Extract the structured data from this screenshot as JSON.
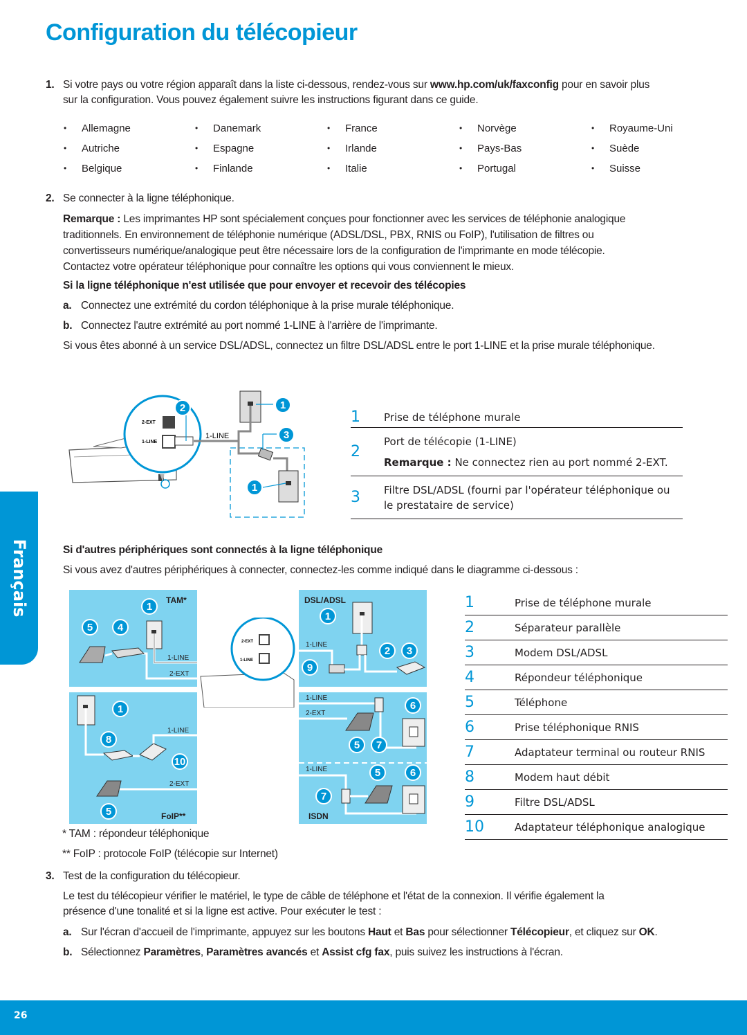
{
  "page": {
    "title": "Configuration du télécopieur",
    "language_tab": "Français",
    "page_number": "26",
    "accent_color": "#0096d6"
  },
  "step1": {
    "number": "1.",
    "text_before": "Si votre pays ou votre région apparaît dans la liste ci-dessous, rendez-vous sur ",
    "link": "www.hp.com/uk/faxconfig",
    "text_after": " pour en savoir plus",
    "line2": "sur la configuration. Vous pouvez également suivre les instructions figurant dans ce guide.",
    "countries": [
      "Allemagne",
      "Danemark",
      "France",
      "Norvège",
      "Royaume-Uni",
      "Autriche",
      "Espagne",
      "Irlande",
      "Pays-Bas",
      "Suède",
      "Belgique",
      "Finlande",
      "Italie",
      "Portugal",
      "Suisse"
    ]
  },
  "step2": {
    "number": "2.",
    "heading": "Se connecter à la ligne téléphonique.",
    "note_label": "Remarque :",
    "note_lines": [
      " Les imprimantes HP sont spécialement conçues pour fonctionner avec les services de téléphonie analogique",
      "traditionnels. En environnement de téléphonie numérique (ADSL/DSL, PBX, RNIS ou FoIP), l'utilisation de filtres ou",
      "convertisseurs numérique/analogique peut être nécessaire lors de la configuration de l'imprimante en mode télécopie.",
      "Contactez votre opérateur téléphonique pour connaître les options qui vous conviennent le mieux."
    ],
    "subheading1": "Si la ligne téléphonique n'est utilisée que pour envoyer et recevoir des télécopies",
    "sub_a_label": "a.",
    "sub_a": "Connectez une extrémité du cordon téléphonique à la prise murale téléphonique.",
    "sub_b_label": "b.",
    "sub_b": "Connectez l'autre extrémité au port nommé 1-LINE à l'arrière de l'imprimante.",
    "dsl_note": "Si vous êtes abonné à un service DSL/ADSL, connectez un filtre DSL/ADSL entre le port 1-LINE et la prise murale téléphonique.",
    "diagram1": {
      "port_2ext": "2-EXT",
      "port_1line": "1-LINE",
      "cable_label": "1-LINE",
      "badges": [
        "2",
        "1",
        "3",
        "1"
      ]
    },
    "legend1": [
      {
        "num": "1",
        "text": "Prise de téléphone murale"
      },
      {
        "num": "2",
        "text": "Port de télécopie (1-LINE)",
        "note_label": "Remarque :",
        "note": " Ne connectez rien au port nommé 2-EXT."
      },
      {
        "num": "3",
        "text": "Filtre DSL/ADSL (fourni par l'opérateur téléphonique ou",
        "text2": "le prestataire de service)"
      }
    ],
    "subheading2": "Si d'autres périphériques sont connectés à la ligne téléphonique",
    "sub2_text": "Si vous avez d'autres périphériques à connecter, connectez-les comme indiqué dans le diagramme ci-dessous :",
    "diagram2": {
      "panels": {
        "tam": "TAM*",
        "dsl": "DSL/ADSL",
        "foip": "FoIP**",
        "isdn": "ISDN"
      },
      "line_1line": "1-LINE",
      "line_2ext": "2-EXT"
    },
    "legend2": [
      {
        "num": "1",
        "text": "Prise de téléphone murale"
      },
      {
        "num": "2",
        "text": "Séparateur parallèle"
      },
      {
        "num": "3",
        "text": "Modem DSL/ADSL"
      },
      {
        "num": "4",
        "text": "Répondeur téléphonique"
      },
      {
        "num": "5",
        "text": "Téléphone"
      },
      {
        "num": "6",
        "text": "Prise téléphonique RNIS"
      },
      {
        "num": "7",
        "text": "Adaptateur terminal ou routeur RNIS"
      },
      {
        "num": "8",
        "text": "Modem haut débit"
      },
      {
        "num": "9",
        "text": "Filtre DSL/ADSL"
      },
      {
        "num": "10",
        "text": "Adaptateur téléphonique analogique"
      }
    ],
    "footnote1": "*  TAM : répondeur téléphonique",
    "footnote2": "**  FoIP : protocole FoIP (télécopie sur Internet)"
  },
  "step3": {
    "number": "3.",
    "heading": "Test de la configuration du télécopieur.",
    "para1": "Le test du télécopieur vérifier le matériel, le type de câble de téléphone et l'état de la connexion. Il vérifie également la",
    "para2": "présence d'une tonalité et si la ligne est active. Pour exécuter le test :",
    "a_label": "a.",
    "a_parts": [
      "Sur l'écran d'accueil de l'imprimante, appuyez sur les boutons ",
      "Haut",
      " et ",
      "Bas",
      " pour sélectionner ",
      "Télécopieur",
      ", et cliquez sur ",
      "OK",
      "."
    ],
    "b_label": "b.",
    "b_parts": [
      "Sélectionnez ",
      "Paramètres",
      ", ",
      "Paramètres avancés",
      " et ",
      "Assist cfg fax",
      ", puis suivez les instructions à l'écran."
    ]
  }
}
